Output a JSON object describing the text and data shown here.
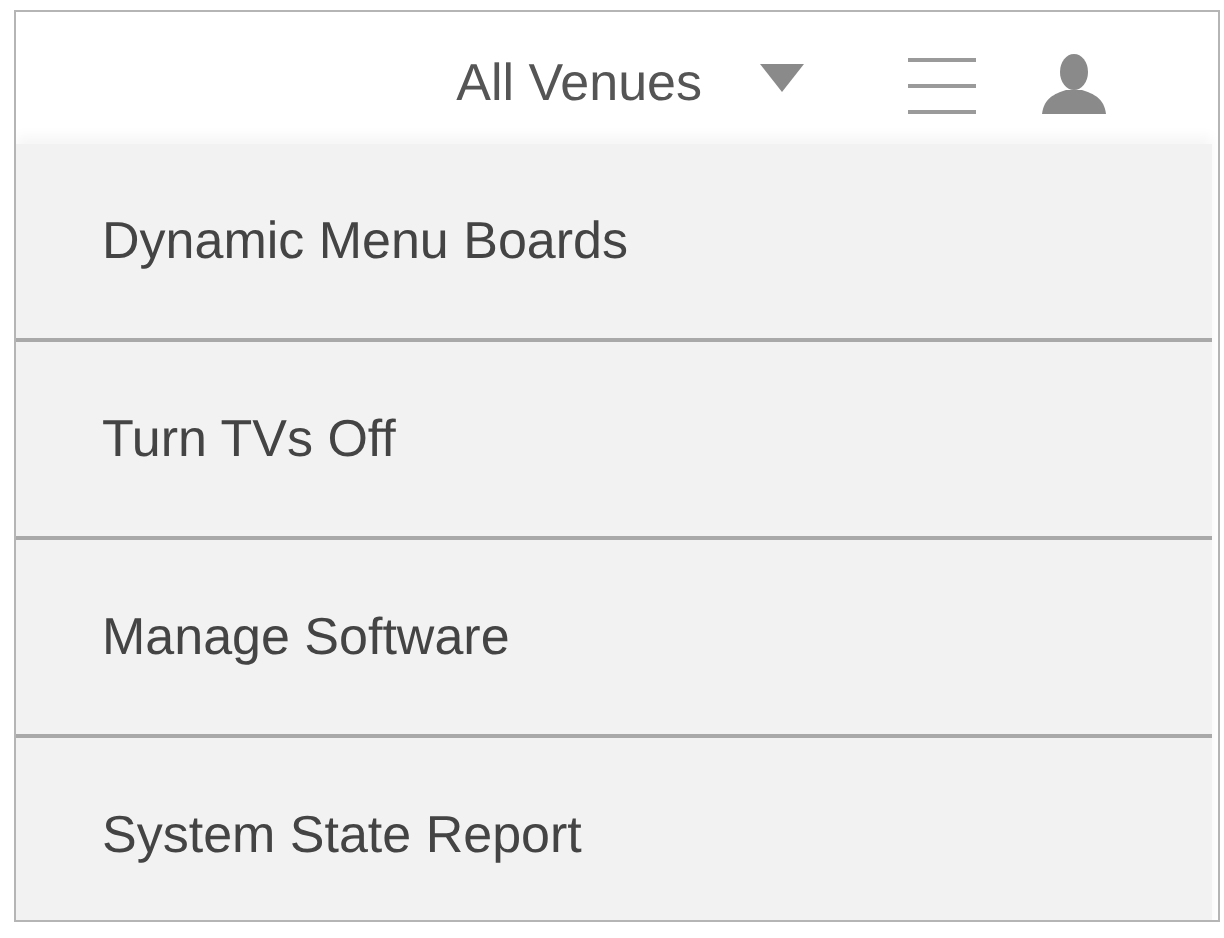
{
  "header": {
    "venue_selector": "All Venues"
  },
  "menu": {
    "items": [
      {
        "label": "Dynamic Menu Boards"
      },
      {
        "label": "Turn TVs Off"
      },
      {
        "label": "Manage Software"
      },
      {
        "label": "System State Report"
      }
    ]
  }
}
